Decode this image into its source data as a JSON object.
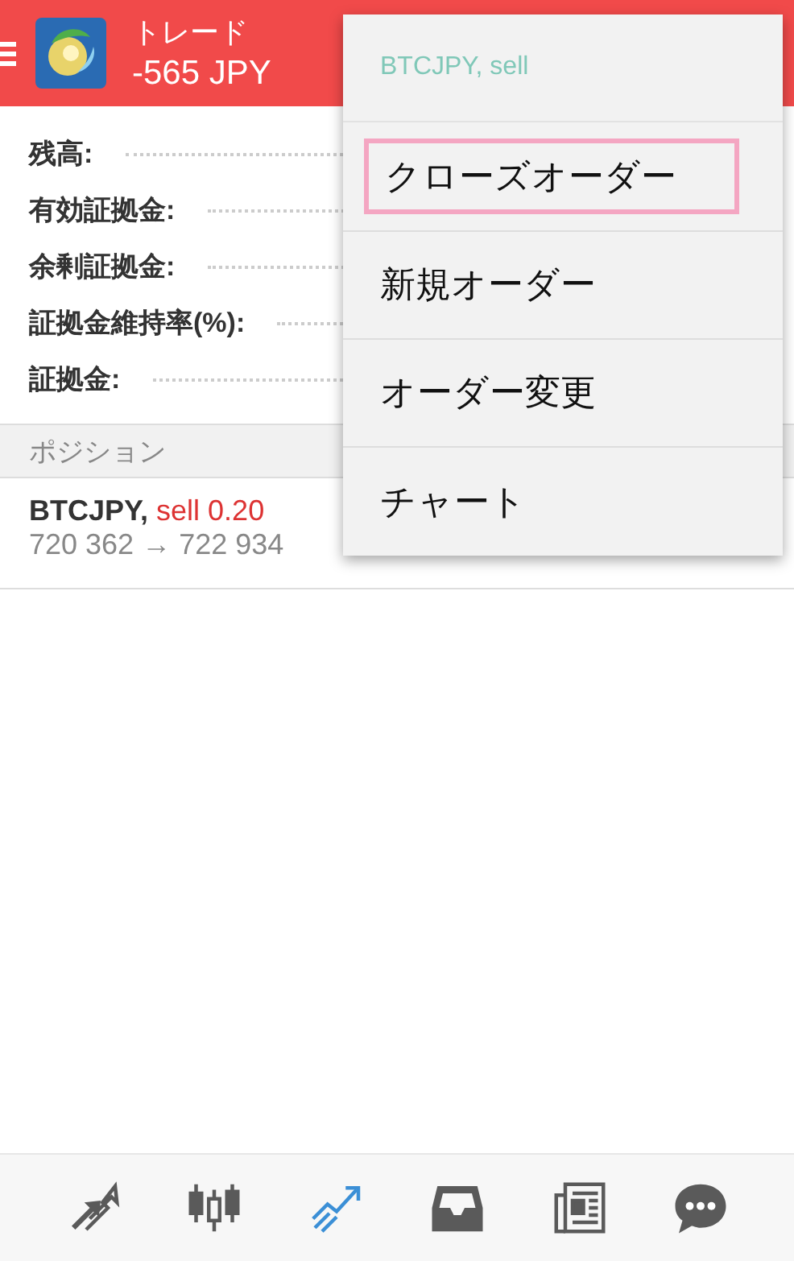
{
  "header": {
    "title": "トレード",
    "profit": "-565 JPY"
  },
  "summary": [
    {
      "label": "残高:"
    },
    {
      "label": "有効証拠金:"
    },
    {
      "label": "余剰証拠金:"
    },
    {
      "label": "証拠金維持率(%):"
    },
    {
      "label": "証拠金:"
    }
  ],
  "positions_section": {
    "title": "ポジション"
  },
  "positions": [
    {
      "symbol": "BTCJPY,",
      "side": "sell 0.20",
      "prices": "720 362 → 722 934"
    }
  ],
  "context_menu": {
    "title": "BTCJPY, sell",
    "items": [
      {
        "label": "クローズオーダー",
        "selected": true
      },
      {
        "label": "新規オーダー",
        "selected": false
      },
      {
        "label": "オーダー変更",
        "selected": false
      },
      {
        "label": "チャート",
        "selected": false
      }
    ]
  },
  "bottom_nav": [
    {
      "kind": "trade",
      "selected": false
    },
    {
      "kind": "quotes",
      "selected": false
    },
    {
      "kind": "trend",
      "selected": true
    },
    {
      "kind": "mailbox",
      "selected": false
    },
    {
      "kind": "news",
      "selected": false
    },
    {
      "kind": "chat",
      "selected": false
    }
  ]
}
